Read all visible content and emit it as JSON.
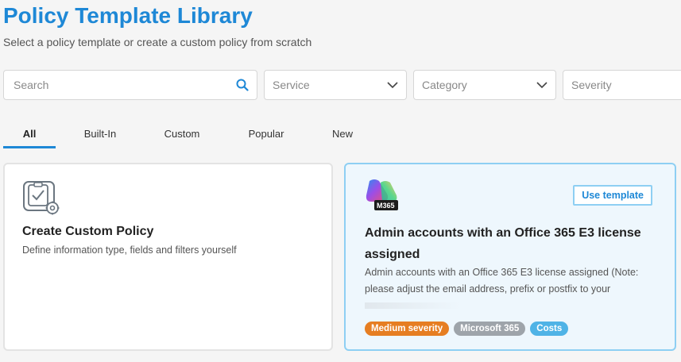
{
  "header": {
    "title": "Policy Template Library",
    "subtitle": "Select a policy template or create a custom policy from scratch"
  },
  "filters": {
    "search_placeholder": "Search",
    "service_placeholder": "Service",
    "category_placeholder": "Category",
    "severity_placeholder": "Severity"
  },
  "tabs": [
    {
      "label": "All",
      "active": true
    },
    {
      "label": "Built-In",
      "active": false
    },
    {
      "label": "Custom",
      "active": false
    },
    {
      "label": "Popular",
      "active": false
    },
    {
      "label": "New",
      "active": false
    }
  ],
  "custom_card": {
    "title": "Create Custom Policy",
    "description": "Define information type, fields and filters yourself",
    "icon": "policy-settings-icon"
  },
  "template_card": {
    "icon_label": "M365",
    "use_button": "Use template",
    "title": "Admin accounts with an Office 365 E3 license assigned",
    "description": "Admin accounts with an Office 365 E3 license assigned (Note: please adjust the email address, prefix or postfix to your",
    "badges": [
      {
        "label": "Medium severity",
        "color": "#e67e22"
      },
      {
        "label": "Microsoft 365",
        "color": "#9ea4aa"
      },
      {
        "label": "Costs",
        "color": "#4fb3e6"
      }
    ]
  },
  "colors": {
    "accent": "#1e88d6",
    "template_border": "#8ecff3"
  }
}
